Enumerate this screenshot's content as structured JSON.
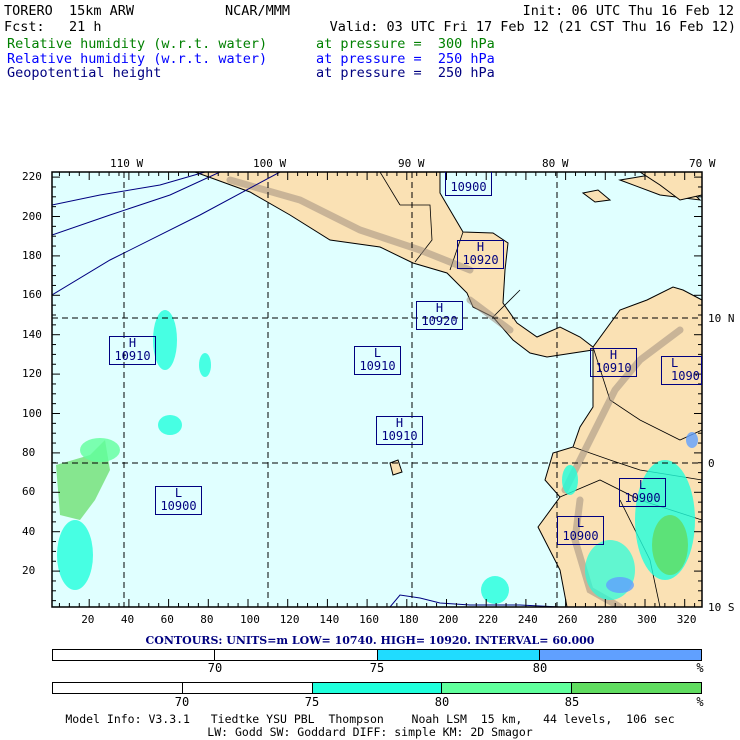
{
  "header": {
    "model": "TORERO  15km ARW",
    "org": "NCAR/MMM",
    "init": "Init: 06 UTC Thu 16 Feb 12",
    "fcst": "Fcst:   21 h",
    "valid": "Valid: 03 UTC Fri 17 Feb 12 (21 CST Thu 16 Feb 12)",
    "fields": [
      {
        "name": "Relative humidity (w.r.t. water)",
        "level": "at pressure =  300 hPa",
        "color": "#008000"
      },
      {
        "name": "Relative humidity (w.r.t. water)",
        "level": "at pressure =  250 hPa",
        "color": "#0000ff"
      },
      {
        "name": "Geopotential height",
        "level": "at pressure =  250 hPa",
        "color": "#000080"
      }
    ]
  },
  "map": {
    "lon_labels": [
      "110 W",
      "100 W",
      "90 W",
      "80 W",
      "70 W"
    ],
    "lat_labels": [
      "10 N",
      "0",
      "10 S"
    ],
    "y_ticks": [
      "220",
      "200",
      "180",
      "160",
      "140",
      "120",
      "100",
      "80",
      "60",
      "40",
      "20"
    ],
    "x_ticks": [
      "20",
      "40",
      "60",
      "80",
      "100",
      "120",
      "140",
      "160",
      "180",
      "200",
      "220",
      "240",
      "260",
      "280",
      "300",
      "320"
    ],
    "systems": [
      {
        "type": "H",
        "value": "10910"
      },
      {
        "type": "L",
        "value": "10910"
      },
      {
        "type": "H",
        "value": "10910"
      },
      {
        "type": "L",
        "value": "10900"
      },
      {
        "type": "H",
        "value": "10920"
      },
      {
        "type": "H",
        "value": "10920"
      },
      {
        "type": "H",
        "value": "10900"
      },
      {
        "type": "H",
        "value": "10910"
      },
      {
        "type": "L",
        "value": "1090"
      },
      {
        "type": "L",
        "value": "10900"
      },
      {
        "type": "L",
        "value": "10900"
      }
    ],
    "colors": {
      "ocean": "#e0ffff",
      "land": "#fae1b4",
      "contour": "#000080"
    }
  },
  "contours": "CONTOURS:  UNITS=m  LOW=  10740.      HIGH=  10920.      INTERVAL=    60.000",
  "colorbar_250": {
    "labels": [
      "70",
      "75",
      "80",
      "%"
    ],
    "colors": [
      "#ffffff",
      "#ffffff",
      "#20dcff",
      "#60a0ff"
    ]
  },
  "colorbar_300": {
    "labels": [
      "70",
      "75",
      "80",
      "85",
      "%"
    ],
    "colors": [
      "#ffffff",
      "#ffffff",
      "#20ffdc",
      "#60ff9c",
      "#60dc60"
    ]
  },
  "footer": {
    "line1": "Model Info: V3.3.1   Tiedtke YSU PBL  Thompson    Noah LSM  15 km,   44 levels,  106 sec",
    "line2": "LW: Godd SW: Goddard DIFF: simple KM: 2D Smagor"
  }
}
